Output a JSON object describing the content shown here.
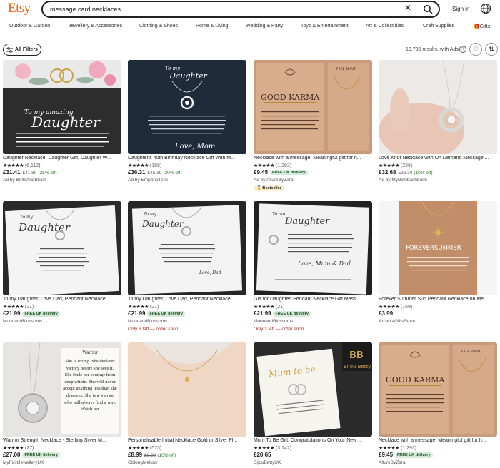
{
  "header": {
    "logo": "Etsy",
    "search_value": "message card necklaces",
    "signin": "Sign in"
  },
  "categories": [
    "Outdoor & Garden",
    "Jewellery & Accessories",
    "Clothing & Shoes",
    "Home & Living",
    "Wedding & Party",
    "Toys & Entertainment",
    "Art & Collectibles",
    "Craft Supplies",
    "Gifts"
  ],
  "toolbar": {
    "filters_label": "All Filters",
    "results_text": "10,736 results, with Ads"
  },
  "listings": [
    {
      "title": "Daughter Necklace, Daughter Gift, Daughter W...",
      "stars": "★★★★★",
      "count": "(6,112)",
      "price": "£31.41",
      "orig": "£41.89",
      "disc": "(25% off)",
      "free": "",
      "shop": "Ad by BellaAndBlush",
      "alert": "",
      "badge": "",
      "thumb_top": "To my amazing",
      "thumb_main": "Daughter"
    },
    {
      "title": "Daughter's 40th Birthday Necklace Gift With M...",
      "stars": "★★★★★",
      "count": "(188)",
      "price": "£36.31",
      "orig": "£45.39",
      "disc": "(20% off)",
      "free": "",
      "shop": "Ad by EmporioTees",
      "alert": "",
      "badge": "",
      "thumb_top": "To my",
      "thumb_main": "Daughter",
      "thumb_sign": "Love, Mom"
    },
    {
      "title": "Necklace with a message. Meaningful gift for h...",
      "stars": "★★★★★",
      "count": "(1,293)",
      "price": "£9.45",
      "orig": "",
      "disc": "",
      "free": "FREE UK delivery",
      "shop": "Ad by AllureByZara",
      "alert": "",
      "badge": "Bestseller",
      "thumb_main": "GOOD KARMA",
      "thumb_side": "FREE SPIRIT"
    },
    {
      "title": "Love Knot Necklace with On Demand Message ...",
      "stars": "★★★★★",
      "count": "(226)",
      "price": "£32.68",
      "orig": "£36.30",
      "disc": "(10% off)",
      "free": "",
      "shop": "Ad by MyBishbashbosh",
      "alert": "",
      "badge": ""
    },
    {
      "title": "To my Daughter, Love Dad, Pendant Necklace ...",
      "stars": "★★★★★",
      "count": "(21)",
      "price": "£21.99",
      "orig": "",
      "disc": "",
      "free": "FREE UK delivery",
      "shop": "MoonandBlossoms",
      "alert": "",
      "badge": "",
      "thumb_top": "To my",
      "thumb_main": "Daughter"
    },
    {
      "title": "To my Daughter, Love Dad, Pendant Necklace ...",
      "stars": "★★★★★",
      "count": "(21)",
      "price": "£21.99",
      "orig": "",
      "disc": "",
      "free": "FREE UK delivery",
      "shop": "MoonandBlossoms",
      "alert": "Only 3 left — order soon",
      "badge": "",
      "thumb_top": "To my",
      "thumb_main": "Daughter",
      "thumb_sign": "Love, Dad"
    },
    {
      "title": "Gift for Daughter, Pendant Necklace Gift Mess...",
      "stars": "★★★★★",
      "count": "(21)",
      "price": "£21.99",
      "orig": "",
      "disc": "",
      "free": "FREE UK delivery",
      "shop": "MoonandBlossoms",
      "alert": "Only 3 left — order soon",
      "badge": "",
      "thumb_top": "To our",
      "thumb_main": "Daughter",
      "thumb_sign": "Love, Mum & Dad"
    },
    {
      "title": "Forever Summer Sun Pendant Necklace on Me...",
      "stars": "★★★★★",
      "count": "(169)",
      "price": "£3.99",
      "orig": "",
      "disc": "",
      "free": "",
      "shop": "ArcadiaGiftsStore",
      "alert": "",
      "badge": "",
      "thumb_main": "FOREVERSUMMER"
    },
    {
      "title": "Warrior Strength Necklace - Sterling Silver M...",
      "stars": "★★★★★",
      "count": "(27)",
      "price": "£27.00",
      "orig": "",
      "disc": "",
      "free": "FREE UK delivery",
      "shop": "MyFirstJewelleryUK",
      "alert": "",
      "badge": "",
      "thumb_main": "Warrior",
      "thumb_body": "She is strong. She declares victory before she sees it. She finds her courage from deep within. She will never accept anything less than she deserves. She is a warrior who will always find a way. Watch her"
    },
    {
      "title": "Personalisable Initial Necklace Gold or Silver Pl...",
      "stars": "★★★★★",
      "count": "(573)",
      "price": "£8.99",
      "orig": "£9.99",
      "disc": "(10% off)",
      "free": "",
      "shop": "OblongMellow",
      "alert": "",
      "badge": ""
    },
    {
      "title": "Mum To Be Gift, Congratulations On Your New ...",
      "stars": "★★★★★",
      "count": "(3,142)",
      "price": "£20.65",
      "orig": "",
      "disc": "",
      "free": "",
      "shop": "BijouBettyUK",
      "alert": "",
      "badge": "",
      "thumb_main": "Mum to be",
      "thumb_brand": "Bijou Betty"
    },
    {
      "title": "Necklace with a message. Meaningful gift for h...",
      "stars": "★★★★★",
      "count": "(1,293)",
      "price": "£9.45",
      "orig": "",
      "disc": "",
      "free": "FREE UK delivery",
      "shop": "AllureByZara",
      "alert": "",
      "badge": "",
      "thumb_main": "GOOD KARMA",
      "thumb_side": "FREE SPIRIT"
    }
  ]
}
